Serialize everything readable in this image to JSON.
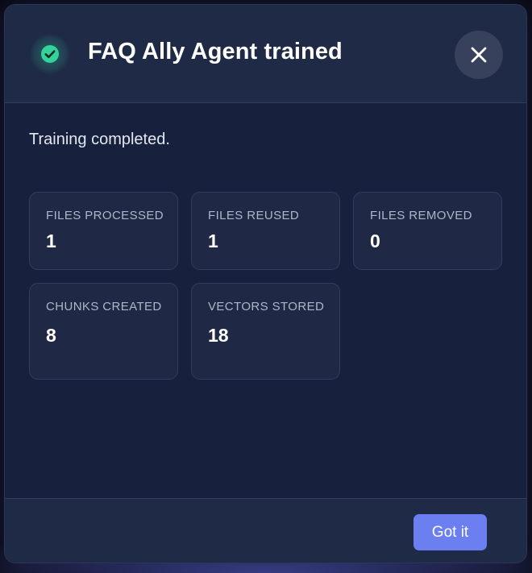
{
  "dialog": {
    "title": "FAQ Ally Agent trained",
    "message": "Training completed.",
    "close_icon": "close-icon",
    "status_icon": "check-circle-icon",
    "accent_color": "#34d399"
  },
  "stats": [
    {
      "label": "FILES PROCESSED",
      "value": "1"
    },
    {
      "label": "FILES REUSED",
      "value": "1"
    },
    {
      "label": "FILES REMOVED",
      "value": "0"
    },
    {
      "label": "CHUNKS CREATED",
      "value": "8"
    },
    {
      "label": "VECTORS STORED",
      "value": "18"
    }
  ],
  "footer": {
    "button_label": "Got it",
    "button_color": "#6b7ff0"
  }
}
